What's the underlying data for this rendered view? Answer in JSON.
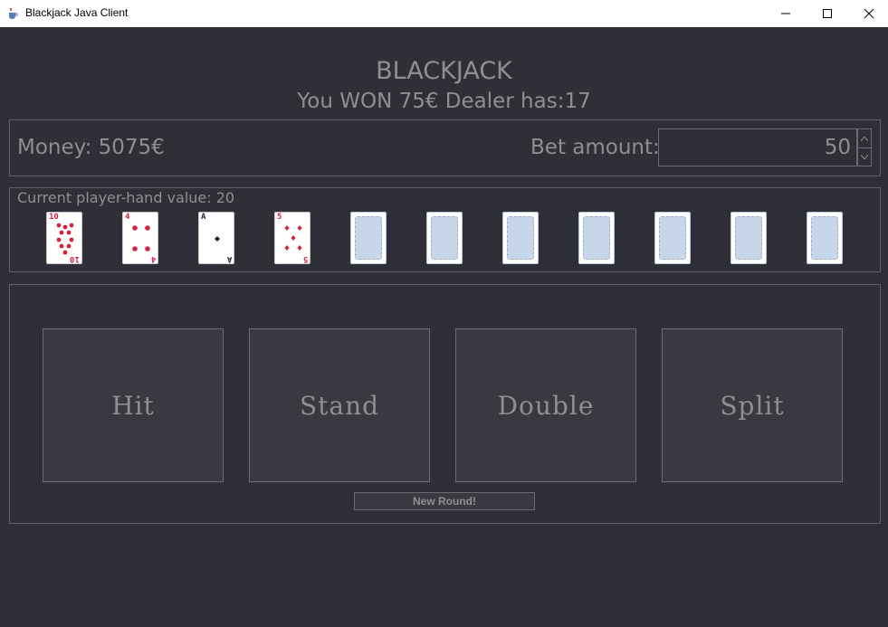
{
  "window": {
    "title": "Blackjack Java Client",
    "minimize_icon": "minimize-icon",
    "maximize_icon": "maximize-icon",
    "close_icon": "close-icon"
  },
  "header": {
    "title": "BLACKJACK",
    "status": "You WON 75€ Dealer has:17"
  },
  "money": {
    "label": "Money: 5075€",
    "bet_label": "Bet amount:",
    "bet_value": "50"
  },
  "hand": {
    "label": "Current player-hand value: 20",
    "cards": [
      {
        "rank": "10",
        "suit": "hearts",
        "color": "#d4213d"
      },
      {
        "rank": "4",
        "suit": "hearts",
        "color": "#d4213d"
      },
      {
        "rank": "A",
        "suit": "spades",
        "color": "#1e2a3a"
      },
      {
        "rank": "5",
        "suit": "diamonds",
        "color": "#d4213d"
      }
    ],
    "empty_slots": 7
  },
  "actions": {
    "hit": "Hit",
    "stand": "Stand",
    "double": "Double",
    "split": "Split",
    "new_round": "New Round!"
  },
  "colors": {
    "background": "#2f3037",
    "text": "#8e8f94",
    "card_back": "#c8d6ea",
    "red_suit": "#d4213d"
  }
}
